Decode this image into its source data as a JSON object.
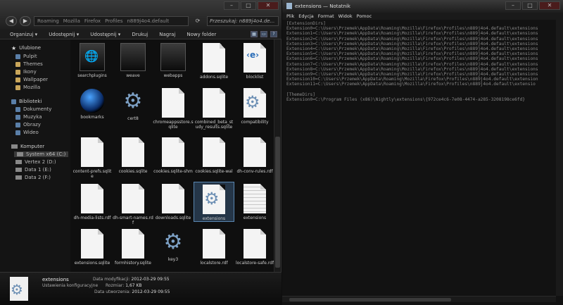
{
  "explorer": {
    "breadcrumb": [
      "Roaming",
      "Mozilla",
      "Firefox",
      "Profiles",
      "n889j4o4.default"
    ],
    "search_placeholder": "Przeszukaj: n889j4o4.de...",
    "toolbar": {
      "organize": "Organizuj ▾",
      "share": "Udostępnij ▾",
      "share_with": "Udostępnij ▾",
      "print": "Drukuj",
      "new_item": "Nagraj",
      "new_folder": "Nowy folder"
    },
    "sidebar": {
      "favorites_label": "Ulubione",
      "favorites": [
        "Pulpit",
        "Themes",
        "Ikony",
        "Wallpaper",
        "Mozilla"
      ],
      "libraries_label": "Biblioteki",
      "libraries": [
        "Dokumenty",
        "Muzyka",
        "Obrazy",
        "Wideo"
      ],
      "computer_label": "Komputer",
      "drives": [
        "System x64 (C:)",
        "Vertex 2 (D:)",
        "Data 1 (E:)",
        "Data 2 (F:)"
      ]
    },
    "files": [
      {
        "label": "searchplugins",
        "icon": "folder-web"
      },
      {
        "label": "weave",
        "icon": "folder"
      },
      {
        "label": "webapps",
        "icon": "folder"
      },
      {
        "label": "addons.sqlite",
        "icon": "doc"
      },
      {
        "label": "blocklist",
        "icon": "doc-web"
      },
      {
        "label": "bookmarks",
        "icon": "globe"
      },
      {
        "label": "cert8",
        "icon": "gear"
      },
      {
        "label": "chromeappsstore.sqlite",
        "icon": "doc"
      },
      {
        "label": "combined_beta_study_results.sqlite",
        "icon": "doc"
      },
      {
        "label": "compatibility",
        "icon": "doc-gear"
      },
      {
        "label": "content-prefs.sqlite",
        "icon": "doc"
      },
      {
        "label": "cookies.sqlite",
        "icon": "doc"
      },
      {
        "label": "cookies.sqlite-shm",
        "icon": "doc"
      },
      {
        "label": "cookies.sqlite-wal",
        "icon": "doc"
      },
      {
        "label": "dh-conv-rules.rdf",
        "icon": "doc"
      },
      {
        "label": "dh-media-lists.rdf",
        "icon": "doc"
      },
      {
        "label": "dh-smart-names.rdf",
        "icon": "doc"
      },
      {
        "label": "downloads.sqlite",
        "icon": "doc"
      },
      {
        "label": "extensions",
        "icon": "doc-gear",
        "selected": true
      },
      {
        "label": "extensions",
        "icon": "doc-lines"
      },
      {
        "label": "extensions.sqlite",
        "icon": "doc"
      },
      {
        "label": "formhistory.sqlite",
        "icon": "doc"
      },
      {
        "label": "key3",
        "icon": "gear"
      },
      {
        "label": "localstore.rdf",
        "icon": "doc"
      },
      {
        "label": "localstore-safe.rdf",
        "icon": "doc"
      }
    ],
    "details": {
      "name": "extensions",
      "type": "Ustawienia konfiguracyjne",
      "modified_label": "Data modyfikacji:",
      "modified": "2012-03-29 09:55",
      "size_label": "Rozmiar:",
      "size": "1,67 KB",
      "created_label": "Data utworzenia:",
      "created": "2012-03-29 09:55"
    }
  },
  "notepad": {
    "title": "extensions — Notatnik",
    "menu": [
      "Plik",
      "Edycja",
      "Format",
      "Widok",
      "Pomoc"
    ],
    "text": "[ExtensionDirs]\nExtension0=C:\\Users\\Przemek\\AppData\\Roaming\\Mozilla\\Firefox\\Profiles\\n889j4o4.default\\extensions\nExtension1=C:\\Users\\Przemek\\AppData\\Roaming\\Mozilla\\Firefox\\Profiles\\n889j4o4.default\\extensions\nExtension2=C:\\Users\\Przemek\\AppData\\Roaming\\Mozilla\\Firefox\\Profiles\\n889j4o4.default\\extensions\nExtension3=C:\\Users\\Przemek\\AppData\\Roaming\\Mozilla\\Firefox\\Profiles\\n889j4o4.default\\extensions\nExtension4=C:\\Users\\Przemek\\AppData\\Roaming\\Mozilla\\Firefox\\Profiles\\n889j4o4.default\\extensions\nExtension5=C:\\Users\\Przemek\\AppData\\Roaming\\Mozilla\\Firefox\\Profiles\\n889j4o4.default\\extensions\nExtension6=C:\\Users\\Przemek\\AppData\\Roaming\\Mozilla\\Firefox\\Profiles\\n889j4o4.default\\extensions\nExtension7=C:\\Users\\Przemek\\AppData\\Roaming\\Mozilla\\Firefox\\Profiles\\n889j4o4.default\\extensions\nExtension8=C:\\Users\\Przemek\\AppData\\Roaming\\Mozilla\\Firefox\\Profiles\\n889j4o4.default\\extensions\nExtension9=C:\\Users\\Przemek\\AppData\\Roaming\\Mozilla\\Firefox\\Profiles\\n889j4o4.default\\extensions\nExtension10=C:\\Users\\Przemek\\AppData\\Roaming\\Mozilla\\Firefox\\Profiles\\n889j4o4.default\\extension\nExtension11=C:\\Users\\Przemek\\AppData\\Roaming\\Mozilla\\Firefox\\Profiles\\n889j4o4.default\\extensio\n\n[ThemeDirs]\nExtension0=C:\\Program Files (x86)\\Nightly\\extensions\\{972ce4c6-7e08-4474-a285-3208198ce6fd}"
  }
}
